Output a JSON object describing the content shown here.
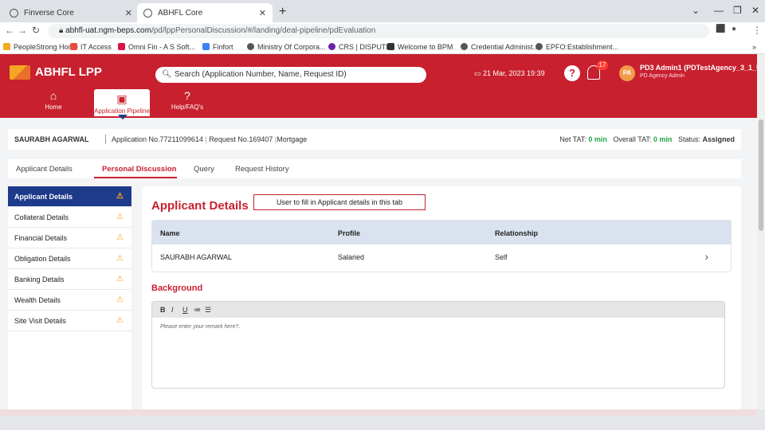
{
  "browser": {
    "tabs": [
      {
        "title": "Finverse Core",
        "active": false
      },
      {
        "title": "ABHFL Core",
        "active": true
      }
    ],
    "url_host": "abhfl-uat.ngm-beps.com",
    "url_path": "/pd/lppPersonalDiscussion/#/landing/deal-pipeline/pdEvaluation",
    "bookmarks": [
      "PeopleStrong Home",
      "IT Access",
      "Omni Fin - A S Soft...",
      "Finfort",
      "Ministry Of Corpora...",
      "CRS | DISPUTE",
      "Welcome to BPM",
      "Credential Administ...",
      "EPFO:Establishment..."
    ]
  },
  "app": {
    "brand": "ABHFL LPP",
    "search_placeholder": "Search (Application Number, Name, Request ID)",
    "datetime": "21 Mar, 2023 19:39",
    "notification_count": "17",
    "avatar_initials": "PA",
    "user_name": "PD3 Admin1 (PDTestAgency_3_1_User_",
    "user_role": "PD Agency Admin",
    "nav": [
      {
        "label": "Home"
      },
      {
        "label": "Application Pipeline"
      },
      {
        "label": "Help/FAQ's"
      }
    ],
    "accent_color": "#c8202e"
  },
  "info": {
    "customer": "SAURABH AGARWAL",
    "application": "Application No.77211099614",
    "request": "Request No.169407",
    "product": "Mortgage",
    "net_tat_label": "Net TAT:",
    "net_tat_value": "0 min",
    "overall_tat_label": "Overall TAT:",
    "overall_tat_value": "0 min",
    "status_label": "Status:",
    "status_value": "Assigned"
  },
  "subtabs": [
    "Applicant Details",
    "Personal Discussion",
    "Query",
    "Request History"
  ],
  "sidebar": {
    "items": [
      {
        "label": "Applicant Details"
      },
      {
        "label": "Collateral Details"
      },
      {
        "label": "Financial Details"
      },
      {
        "label": "Obligation Details"
      },
      {
        "label": "Banking Details"
      },
      {
        "label": "Wealth Details"
      },
      {
        "label": "Site Visit Details"
      }
    ]
  },
  "panel": {
    "title": "Applicant Details",
    "callout": "User to fill in Applicant details in this tab",
    "columns": [
      "Name",
      "Profile",
      "Relationship"
    ],
    "rows": [
      {
        "name": "SAURABH AGARWAL",
        "profile": "Salaried",
        "relationship": "Self"
      }
    ],
    "background_heading": "Background",
    "editor_buttons": [
      "B",
      "I",
      "U",
      "≔",
      "☰"
    ],
    "editor_placeholder": "Please enter your remark here?."
  }
}
